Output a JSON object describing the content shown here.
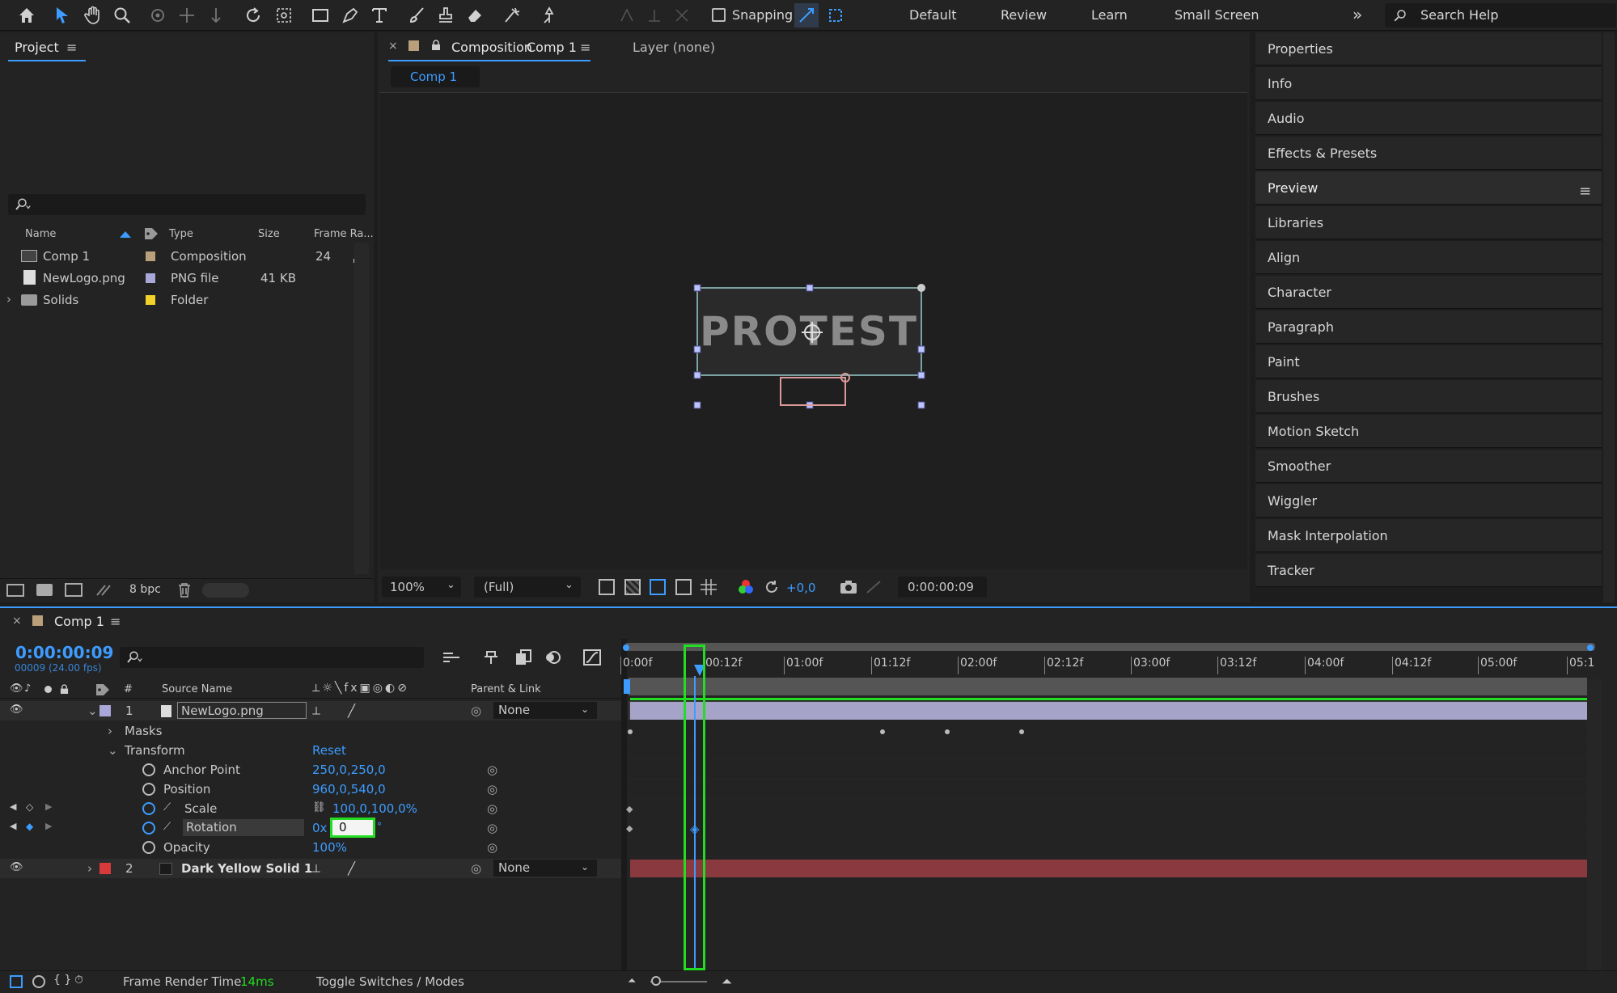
{
  "toolbar": {
    "snapping_label": "Snapping",
    "workspaces": [
      "Default",
      "Review",
      "Learn",
      "Small Screen"
    ],
    "search_placeholder": "Search Help"
  },
  "project": {
    "title": "Project",
    "columns": [
      "Name",
      "Type",
      "Size",
      "Frame Ra..."
    ],
    "rows": [
      {
        "name": "Comp 1",
        "type": "Composition",
        "size": "",
        "fps": "24",
        "color": "#b9a07a"
      },
      {
        "name": "NewLogo.png",
        "type": "PNG file",
        "size": "41 KB",
        "fps": "",
        "color": "#a9a6d8"
      },
      {
        "name": "Solids",
        "type": "Folder",
        "size": "",
        "fps": "",
        "color": "#f2d22a"
      }
    ],
    "bpc_label": "8 bpc"
  },
  "composition": {
    "tab_prefix": "Composition",
    "tab_name": "Comp 1",
    "layer_tab": "Layer (none)",
    "subtab": "Comp 1",
    "logo_text": "PROTEST",
    "zoom": "100%",
    "resolution": "(Full)",
    "exposure": "+0,0",
    "timecode": "0:00:00:09"
  },
  "right_panel": {
    "items": [
      "Properties",
      "Info",
      "Audio",
      "Effects & Presets",
      "Preview",
      "Libraries",
      "Align",
      "Character",
      "Paragraph",
      "Paint",
      "Brushes",
      "Motion Sketch",
      "Smoother",
      "Wiggler",
      "Mask Interpolation",
      "Tracker"
    ]
  },
  "timeline": {
    "comp_tab": "Comp 1",
    "timecode": "0:00:00:09",
    "frame_info": "00009 (24.00 fps)",
    "col_source_name": "Source Name",
    "col_num": "#",
    "col_parent": "Parent & Link",
    "ticks": [
      "0:00f",
      "00:12f",
      "01:00f",
      "01:12f",
      "02:00f",
      "02:12f",
      "03:00f",
      "03:12f",
      "04:00f",
      "04:12f",
      "05:00f",
      "05:1"
    ],
    "layer1": {
      "num": "1",
      "name": "NewLogo.png",
      "parent": "None",
      "color": "#a9a6d8"
    },
    "masks": "Masks",
    "transform": "Transform",
    "reset": "Reset",
    "props": [
      {
        "name": "Anchor Point",
        "value": "250,0,250,0"
      },
      {
        "name": "Position",
        "value": "960,0,540,0"
      },
      {
        "name": "Scale",
        "value": "100,0,100,0%"
      },
      {
        "name": "Rotation",
        "value_prefix": "0x",
        "value_input": "0",
        "unit": "°"
      },
      {
        "name": "Opacity",
        "value": "100%"
      }
    ],
    "layer2": {
      "num": "2",
      "name": "Dark Yellow Solid 1",
      "parent": "None",
      "color": "#d63a3a"
    },
    "render_time_label": "Frame Render Time",
    "render_time_value": "14ms",
    "toggle_label": "Toggle Switches / Modes"
  }
}
